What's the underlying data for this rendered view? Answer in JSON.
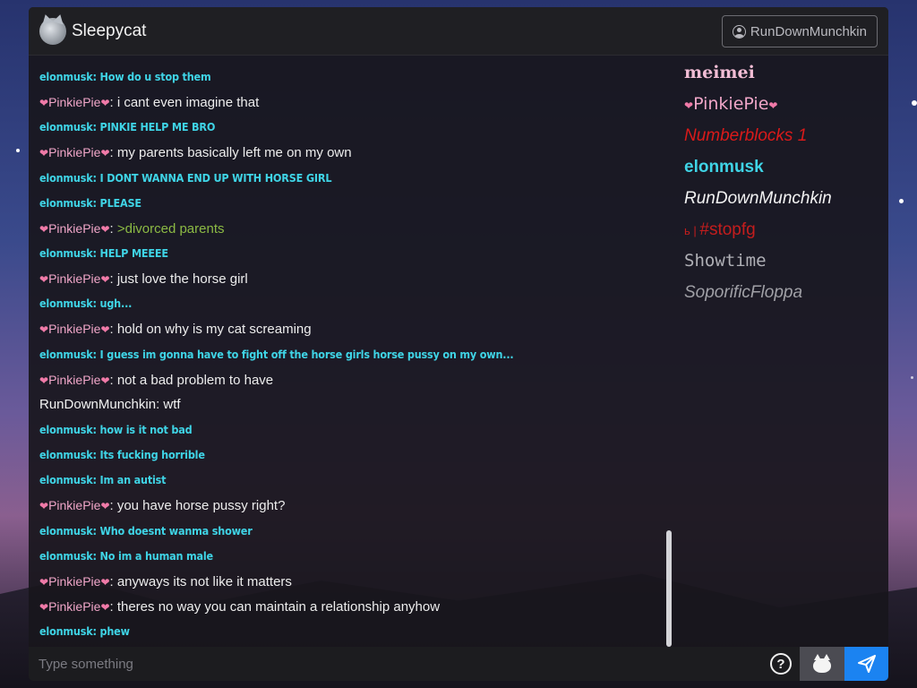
{
  "app": {
    "title": "Sleepycat"
  },
  "header": {
    "user_button_label": "RunDownMunchkin"
  },
  "chat": {
    "messages": [
      {
        "type": "elon",
        "text": "elonmusk: How do u stop them"
      },
      {
        "type": "pinkie",
        "name": "PinkiePie",
        "text": ": i cant even imagine that"
      },
      {
        "type": "elon",
        "text": "elonmusk: PINKIE HELP ME BRO"
      },
      {
        "type": "pinkie",
        "name": "PinkiePie",
        "text": ": my parents basically left me on my own"
      },
      {
        "type": "elon",
        "text": "elonmusk: I DONT WANNA END UP WITH HORSE GIRL"
      },
      {
        "type": "elon",
        "text": "elonmusk: PLEASE"
      },
      {
        "type": "pinkie-green",
        "name": "PinkiePie",
        "text": ">divorced parents"
      },
      {
        "type": "elon",
        "text": "elonmusk: HELP MEEEE"
      },
      {
        "type": "pinkie",
        "name": "PinkiePie",
        "text": ": just love the horse girl"
      },
      {
        "type": "elon",
        "text": "elonmusk: ugh..."
      },
      {
        "type": "pinkie",
        "name": "PinkiePie",
        "text": ": hold on why is my cat screaming"
      },
      {
        "type": "elon",
        "text": "elonmusk: I guess im gonna have to fight off the horse girls horse pussy on my own..."
      },
      {
        "type": "pinkie",
        "name": "PinkiePie",
        "text": ": not a bad problem to have"
      },
      {
        "type": "run",
        "text": "RunDownMunchkin: wtf"
      },
      {
        "type": "elon",
        "text": "elonmusk: how is it not bad"
      },
      {
        "type": "elon",
        "text": "elonmusk: Its fucking horrible"
      },
      {
        "type": "elon",
        "text": "elonmusk: Im an autist"
      },
      {
        "type": "pinkie",
        "name": "PinkiePie",
        "text": ": you have horse pussy right?"
      },
      {
        "type": "elon",
        "text": "elonmusk: Who doesnt wanma shower"
      },
      {
        "type": "elon",
        "text": "elonmusk: No im a human male"
      },
      {
        "type": "pinkie",
        "name": "PinkiePie",
        "text": ": anyways its not like it matters"
      },
      {
        "type": "pinkie",
        "name": "PinkiePie",
        "text": ": theres no way you can maintain a relationship anyhow"
      },
      {
        "type": "elon",
        "text": "elonmusk: phew"
      }
    ]
  },
  "users": {
    "list": [
      "meimei",
      "PinkiePie",
      "Numberblocks 1",
      "elonmusk",
      "RunDownMunchkin",
      "#stopfg",
      "Showtime",
      "SoporificFloppa"
    ],
    "stopfg_prefix": "ь | "
  },
  "input": {
    "placeholder": "Type something",
    "help_label": "?"
  },
  "colors": {
    "elon": "#3fd4e6",
    "pinkie": "#f0a6c8",
    "greentext": "#8cba44",
    "send": "#1b83f1",
    "numberblocks": "#d91a1a"
  }
}
